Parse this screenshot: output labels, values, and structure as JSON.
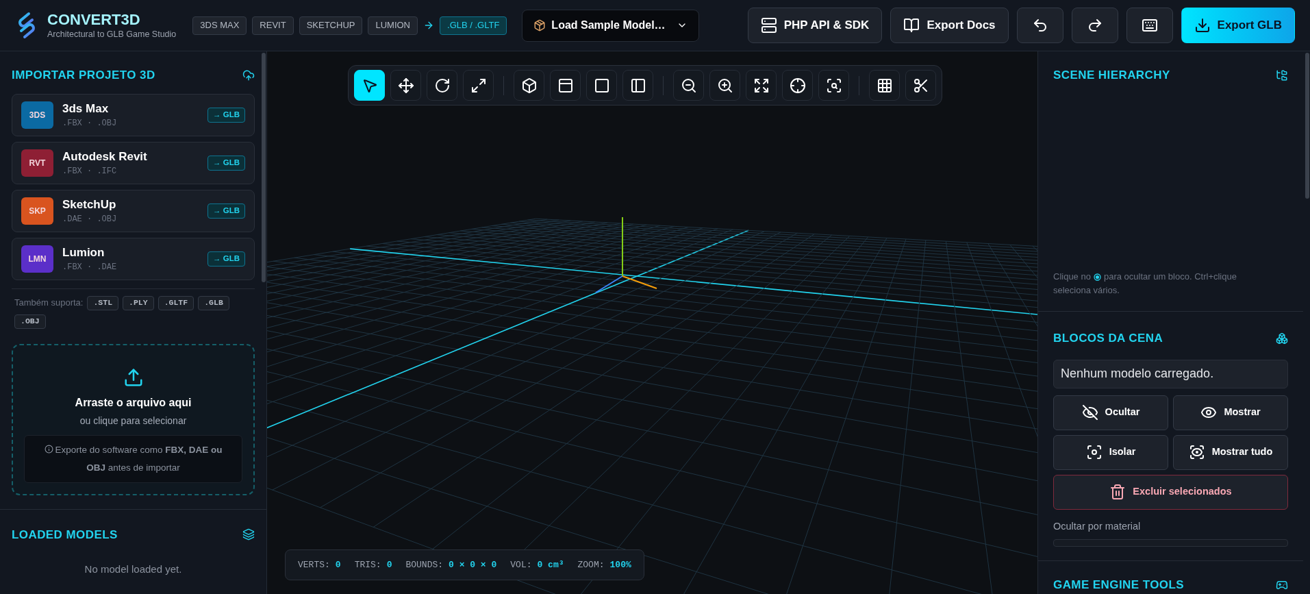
{
  "header": {
    "title": "CONVERT3D",
    "subtitle": "Architectural to GLB Game Studio",
    "source_chips": [
      "3DS MAX",
      "REVIT",
      "SKETCHUP",
      "LUMION"
    ],
    "target_chip": ".GLB / .GLTF",
    "sample_select": "Load Sample Model…",
    "buttons": [
      {
        "kind": "text",
        "label": "PHP API & SDK"
      },
      {
        "kind": "text",
        "label": "Export Docs"
      },
      {
        "kind": "icon"
      },
      {
        "kind": "icon"
      },
      {
        "kind": "icon"
      },
      {
        "kind": "primary",
        "label": "Export GLB"
      }
    ]
  },
  "import_panel": {
    "title": "IMPORTAR PROJETO 3D",
    "importers": [
      {
        "badge": "3DS",
        "name": "3ds Max",
        "formats": ".FBX · .OBJ",
        "action": "→ GLB",
        "color": "#0b6aa3"
      },
      {
        "badge": "RVT",
        "name": "Autodesk Revit",
        "formats": ".FBX · .IFC",
        "action": "→ GLB",
        "color": "#8e1f34"
      },
      {
        "badge": "SKP",
        "name": "SketchUp",
        "formats": ".DAE · .OBJ",
        "action": "→ GLB",
        "color": "#d9541f"
      },
      {
        "badge": "LMN",
        "name": "Lumion",
        "formats": ".FBX · .DAE",
        "action": "→ GLB",
        "color": "#5b2fc9"
      }
    ],
    "also_supports_label": "Também suporta:",
    "also_supports": [
      ".STL",
      ".PLY",
      ".GLTF",
      ".GLB",
      ".OBJ"
    ],
    "dropzone": {
      "title": "Arraste o arquivo aqui",
      "subtitle": "ou clique para selecionar",
      "note": "Exporte do software como **FBX, DAE ou OBJ** antes de importar"
    }
  },
  "loaded_models": {
    "title": "LOADED MODELS",
    "empty": "No model loaded yet."
  },
  "toolbar": [
    [
      {
        "selected": true
      },
      {
        "selected": false
      },
      {
        "selected": false
      },
      {
        "selected": false
      }
    ],
    [
      {
        "selected": false
      },
      {
        "selected": false
      },
      {
        "selected": false
      },
      {
        "selected": false
      }
    ],
    [
      {
        "selected": false
      },
      {
        "selected": false
      },
      {
        "selected": false
      },
      {
        "selected": false
      },
      {
        "selected": false
      }
    ],
    [
      {
        "selected": false
      },
      {
        "selected": false
      }
    ]
  ],
  "stats": [
    {
      "label": "VERTS:",
      "value": "0"
    },
    {
      "label": "TRIS:",
      "value": "0"
    },
    {
      "label": "BOUNDS:",
      "value": "0 × 0 × 0"
    },
    {
      "label": "VOL:",
      "value": "0 cm³"
    },
    {
      "label": "ZOOM:",
      "value": "100%"
    }
  ],
  "scene_hierarchy": {
    "title": "SCENE HIERARCHY",
    "hint_before": "Clique no",
    "hint_after": "para ocultar um bloco. Ctrl+clique",
    "hint_line2": "seleciona vários."
  },
  "scene_blocks": {
    "title": "BLOCOS DA CENA",
    "model_select": "Nenhum modelo carregado.",
    "actions": [
      {
        "kind": "hide",
        "label": "Ocultar"
      },
      {
        "kind": "show",
        "label": "Mostrar"
      },
      {
        "kind": "isolate",
        "label": "Isolar"
      },
      {
        "kind": "show_all",
        "label": "Mostrar tudo"
      },
      {
        "kind": "delete",
        "label": "Excluir selecionados"
      }
    ],
    "material_label": "Ocultar por material"
  },
  "game_engine_tools": {
    "title": "GAME ENGINE TOOLS"
  }
}
